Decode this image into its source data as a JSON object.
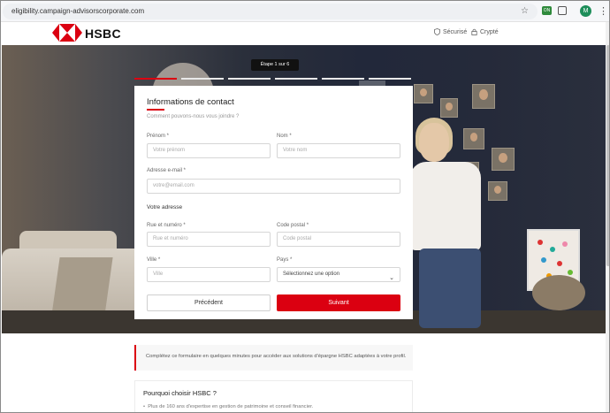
{
  "browser": {
    "url": "eligibility.campaign-advisorscorporate.com",
    "ext_label": "ON",
    "avatar_initial": "M",
    "star_icon": "star-icon",
    "menu_icon": "more-vert-icon"
  },
  "header": {
    "brand": "HSBC",
    "secure": "Sécurisé",
    "encrypted": "Crypté",
    "brand_red": "#db0011"
  },
  "stepper": {
    "label": "Étape 1 sur 6",
    "current_step": 1,
    "total_steps": 6
  },
  "form": {
    "title": "Informations de contact",
    "subtitle": "Comment pouvons-nous vous joindre ?",
    "firstname_label": "Prénom *",
    "firstname_placeholder": "Votre prénom",
    "lastname_label": "Nom *",
    "lastname_placeholder": "Votre nom",
    "email_label": "Adresse e-mail *",
    "email_placeholder": "votre@email.com",
    "address_section": "Votre adresse",
    "street_label": "Rue et numéro *",
    "street_placeholder": "Rue et numéro",
    "postal_label": "Code postal *",
    "postal_placeholder": "Code postal",
    "city_label": "Ville *",
    "city_placeholder": "Ville",
    "country_label": "Pays *",
    "country_value": "Sélectionnez une option",
    "prev_button": "Précédent",
    "next_button": "Suivant"
  },
  "note": {
    "text": "Complétez ce formulaire en quelques minutes pour accéder aux solutions d'épargne HSBC adaptées à votre profil."
  },
  "why": {
    "title": "Pourquoi choisir HSBC ?",
    "item1": "Plus de 160 ans d'expertise en gestion de patrimoine et conseil financier."
  }
}
